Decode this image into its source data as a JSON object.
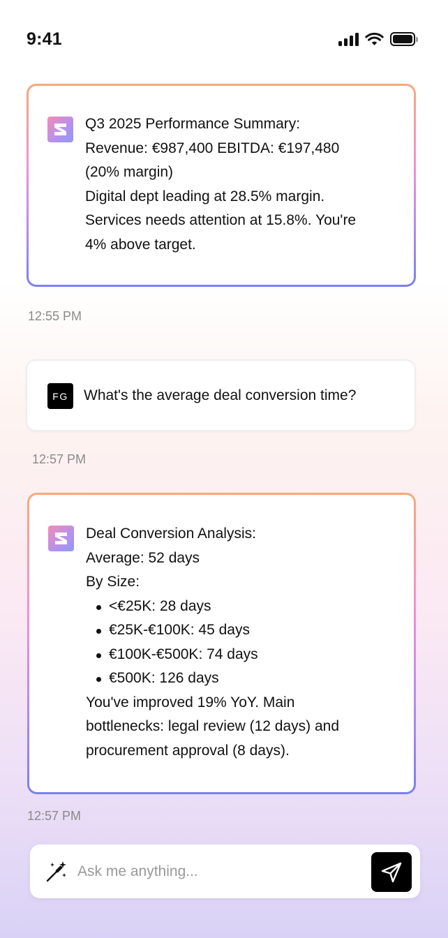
{
  "status": {
    "time": "9:41"
  },
  "messages": [
    {
      "sender": "assistant",
      "lines": [
        "Q3 2025 Performance Summary:",
        "Revenue: €987,400 EBITDA: €197,480",
        "(20% margin)",
        "Digital dept leading at 28.5% margin.",
        "Services needs attention at 15.8%. You're",
        "4% above target."
      ],
      "time": "12:55 PM"
    },
    {
      "sender": "user",
      "avatar_initials": "FG",
      "text": "What's the average deal conversion time?",
      "time": "12:57 PM"
    },
    {
      "sender": "assistant",
      "intro": [
        "Deal Conversion Analysis:",
        "Average: 52 days",
        "By Size:"
      ],
      "bullets": [
        "<€25K: 28 days",
        "€25K-€100K: 45 days",
        "€100K-€500K: 74 days",
        "€500K: 126 days"
      ],
      "outro": [
        "You've improved 19% YoY. Main",
        "bottlenecks: legal review (12 days) and",
        "procurement approval (8 days)."
      ],
      "time": "12:57 PM"
    }
  ],
  "composer": {
    "placeholder": "Ask me anything...",
    "value": ""
  },
  "icons": {
    "status": [
      "signal-icon",
      "wifi-icon",
      "battery-icon"
    ],
    "assistant_avatar": "app-logo-icon",
    "composer": [
      "magic-wand-icon",
      "send-icon"
    ]
  },
  "colors": {
    "card_border_gradient": [
      "#f7a97a",
      "#f58fd2",
      "#b58af0",
      "#7b7ef2"
    ],
    "send_button": "#000000",
    "timestamp": "#8a8a8a"
  }
}
